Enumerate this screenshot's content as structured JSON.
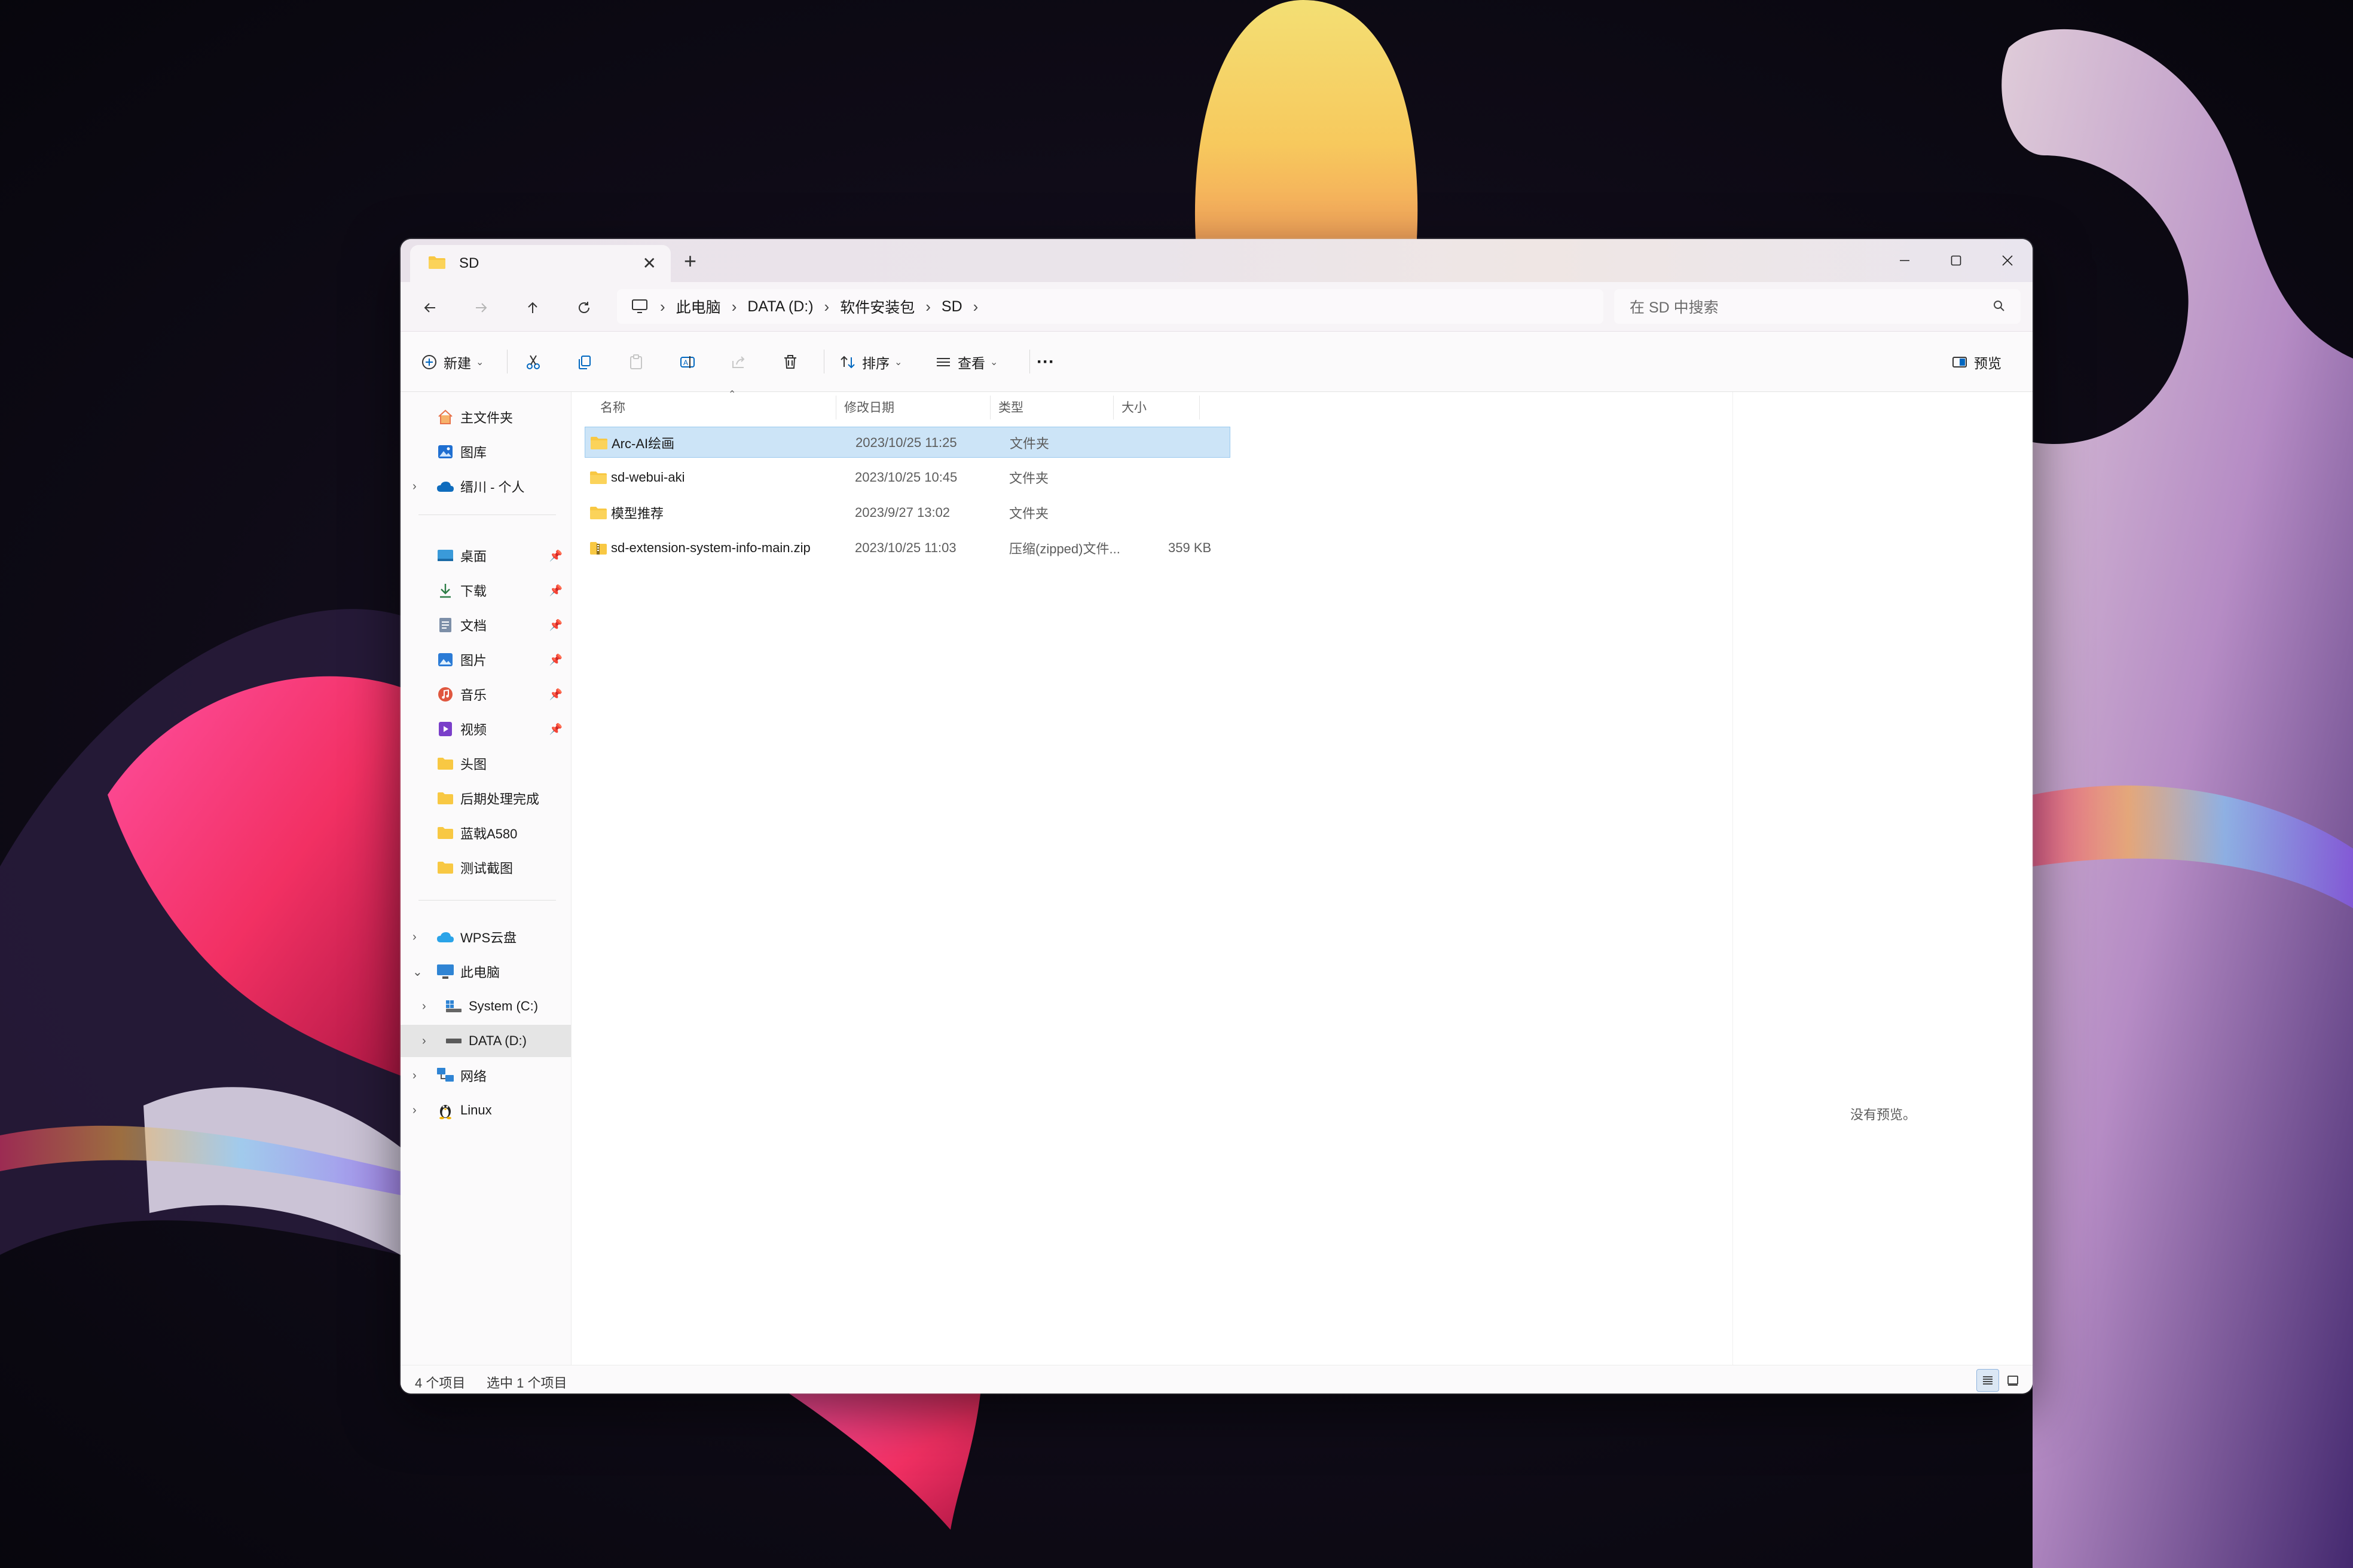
{
  "colors": {
    "accent": "#0067c0",
    "folder": "#f8c843",
    "selection": "#cce4f7"
  },
  "tab": {
    "title": "SD",
    "close_icon": "close-icon",
    "new_tab": "+"
  },
  "window_controls": {
    "minimize": "minimize-icon",
    "maximize": "maximize-icon",
    "close": "close-icon"
  },
  "address_bar": {
    "crumbs": [
      "此电脑",
      "DATA (D:)",
      "软件安装包",
      "SD"
    ]
  },
  "search": {
    "placeholder": "在 SD 中搜索"
  },
  "toolbar": {
    "new_label": "新建",
    "sort_label": "排序",
    "view_label": "查看",
    "more": "···",
    "preview_label": "预览"
  },
  "sidebar": {
    "quick": [
      "主文件夹",
      "图库",
      "缙川 - 个人"
    ],
    "pinned": [
      "桌面",
      "下载",
      "文档",
      "图片",
      "音乐",
      "视频",
      "头图",
      "后期处理完成",
      "蓝戟A580",
      "测试截图"
    ],
    "locations": [
      "WPS云盘",
      "此电脑",
      "System (C:)",
      "DATA (D:)",
      "网络",
      "Linux"
    ]
  },
  "columns": {
    "name": "名称",
    "modified": "修改日期",
    "type": "类型",
    "size": "大小"
  },
  "files": [
    {
      "name": "Arc-AI绘画",
      "modified": "2023/10/25 11:25",
      "type": "文件夹",
      "size": ""
    },
    {
      "name": "sd-webui-aki",
      "modified": "2023/10/25 10:45",
      "type": "文件夹",
      "size": ""
    },
    {
      "name": "模型推荐",
      "modified": "2023/9/27 13:02",
      "type": "文件夹",
      "size": ""
    },
    {
      "name": "sd-extension-system-info-main.zip",
      "modified": "2023/10/25 11:03",
      "type": "压缩(zipped)文件...",
      "size": "359 KB"
    }
  ],
  "preview": {
    "no_preview": "没有预览。"
  },
  "status": {
    "item_count": "4 个项目",
    "selected": "选中 1 个项目"
  }
}
